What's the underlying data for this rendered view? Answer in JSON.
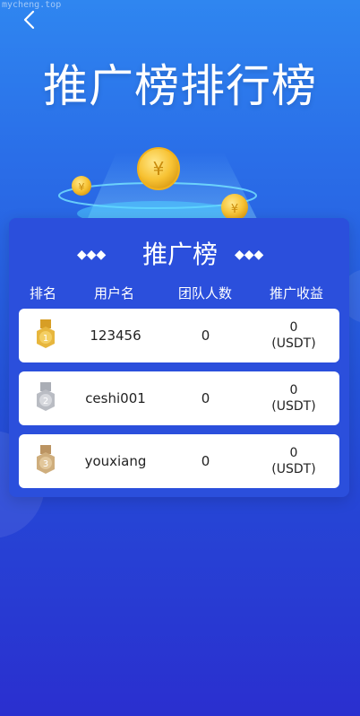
{
  "watermark": "mycheng.top",
  "title": "推广榜排行榜",
  "panel_title": "推广榜",
  "columns": [
    "排名",
    "用户名",
    "团队人数",
    "推广收益"
  ],
  "rows": [
    {
      "rank": "1",
      "username": "123456",
      "team": "0",
      "income_value": "0",
      "income_unit": "(USDT)",
      "medal": "gold-medal-icon",
      "color": "#e7b63d"
    },
    {
      "rank": "2",
      "username": "ceshi001",
      "team": "0",
      "income_value": "0",
      "income_unit": "(USDT)",
      "medal": "silver-medal-icon",
      "color": "#b9bcc3"
    },
    {
      "rank": "3",
      "username": "youxiang",
      "team": "0",
      "income_value": "0",
      "income_unit": "(USDT)",
      "medal": "bronze-medal-icon",
      "color": "#cfae7d"
    }
  ]
}
